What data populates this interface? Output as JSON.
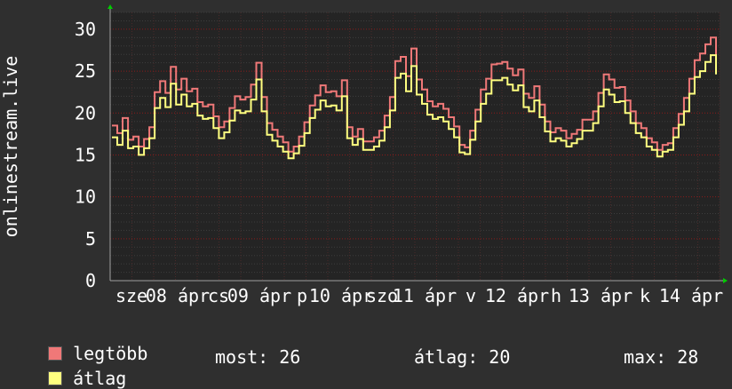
{
  "chart_data": {
    "type": "line",
    "ylabel": "onlinestream.live",
    "ylim": [
      0,
      32
    ],
    "yticks": [
      0,
      5,
      10,
      15,
      20,
      25,
      30
    ],
    "grid": true,
    "xtick_labels": [
      "sze",
      "08 ápr",
      "cs",
      "09 ápr",
      "p",
      "10 ápr",
      "szo",
      "11 ápr",
      "v",
      "12 ápr",
      "h",
      "13 ápr",
      "k",
      "14 ápr"
    ],
    "colors": {
      "max": "#f07878",
      "avg": "#ffff80",
      "grid": "#8b1a1a",
      "axis": "#a0a0a0",
      "arrow": "#00cc00"
    },
    "series": [
      {
        "name": "legtöbb",
        "color": "#f07878",
        "values": [
          18.5,
          17.6,
          19.4,
          16.8,
          17.2,
          16.0,
          16.9,
          18.3,
          22.5,
          23.8,
          22.4,
          25.5,
          22.8,
          24.1,
          22.6,
          22.9,
          21.3,
          20.8,
          21.0,
          19.6,
          18.3,
          19.0,
          20.6,
          22.0,
          21.6,
          21.9,
          23.4,
          26.0,
          21.9,
          18.8,
          18.0,
          17.2,
          16.5,
          15.4,
          16.0,
          17.2,
          18.9,
          20.9,
          22.1,
          23.3,
          22.5,
          22.6,
          22.0,
          23.9,
          18.3,
          17.2,
          18.1,
          16.6,
          16.6,
          17.1,
          17.9,
          19.7,
          21.9,
          26.2,
          26.7,
          24.4,
          27.7,
          24.0,
          22.8,
          21.4,
          20.8,
          21.1,
          20.5,
          19.5,
          18.4,
          16.2,
          15.9,
          17.9,
          20.4,
          22.8,
          24.1,
          25.8,
          25.9,
          26.1,
          25.3,
          24.5,
          25.2,
          22.3,
          21.8,
          23.2,
          21.0,
          19.0,
          17.7,
          18.2,
          17.9,
          17.0,
          17.5,
          18.0,
          19.2,
          19.2,
          20.2,
          22.4,
          24.6,
          24.0,
          23.0,
          23.1,
          21.5,
          20.2,
          18.8,
          18.2,
          17.0,
          16.5,
          15.6,
          16.2,
          16.4,
          18.2,
          19.9,
          21.8,
          24.1,
          26.3,
          27.1,
          28.2,
          29.0,
          26.5
        ],
        "note": ""
      },
      {
        "name": "átlag",
        "color": "#ffff80",
        "values": [
          17.1,
          16.2,
          17.9,
          15.8,
          16.0,
          15.0,
          15.8,
          17.0,
          20.6,
          21.8,
          20.7,
          23.5,
          21.0,
          22.2,
          20.8,
          21.1,
          19.7,
          19.3,
          19.4,
          18.2,
          17.0,
          17.7,
          19.1,
          20.3,
          20.0,
          20.2,
          21.6,
          24.0,
          20.2,
          17.4,
          16.7,
          16.0,
          15.4,
          14.6,
          15.2,
          16.1,
          17.6,
          19.4,
          20.4,
          21.5,
          20.8,
          20.9,
          20.3,
          22.0,
          17.0,
          16.2,
          16.9,
          15.6,
          15.6,
          16.0,
          16.7,
          18.3,
          20.3,
          24.2,
          24.7,
          22.6,
          25.6,
          22.2,
          21.1,
          19.8,
          19.3,
          19.5,
          19.0,
          18.1,
          17.1,
          15.3,
          15.1,
          16.8,
          19.0,
          21.1,
          22.3,
          23.9,
          23.9,
          24.2,
          23.4,
          22.7,
          23.3,
          20.7,
          20.2,
          21.5,
          19.5,
          17.8,
          16.6,
          17.0,
          16.7,
          16.0,
          16.4,
          16.9,
          17.9,
          17.9,
          18.8,
          20.8,
          22.8,
          22.2,
          21.3,
          21.4,
          20.0,
          18.8,
          17.6,
          17.1,
          16.0,
          15.6,
          14.8,
          15.4,
          15.6,
          17.1,
          18.6,
          20.2,
          22.3,
          24.3,
          25.0,
          26.1,
          26.9,
          24.6
        ]
      }
    ]
  },
  "legend": [
    {
      "label": "legtöbb",
      "color": "#f07878"
    },
    {
      "label": "átlag",
      "color": "#ffff80"
    }
  ],
  "stats": {
    "most": "most: 26",
    "avg": "átlag: 20",
    "max": "max: 28"
  }
}
